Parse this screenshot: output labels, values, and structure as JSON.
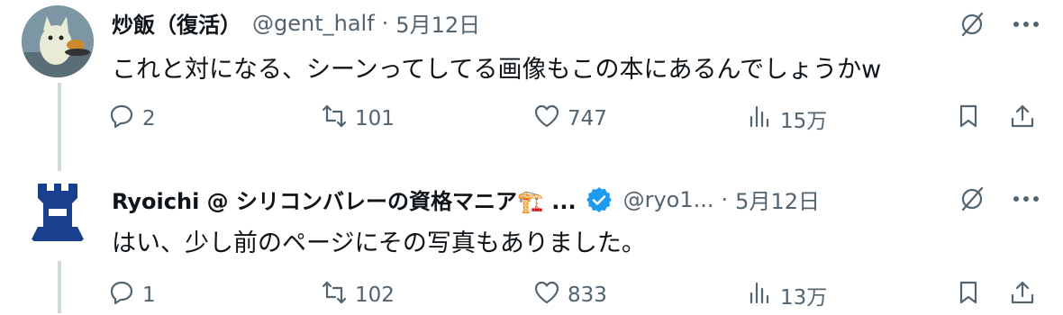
{
  "tweets": [
    {
      "name": "炒飯（復活）",
      "handle": "@gent_half",
      "separator": "·",
      "date": "5月12日",
      "text": "これと対になる、シーンってしてる画像もこの本にあるんでしょうかw",
      "replies": "2",
      "retweets": "101",
      "likes": "747",
      "views": "15万"
    },
    {
      "name": "Ryoichi @ シリコンバレーの資格マニア🏗️ ...",
      "handle": "@ryo1...",
      "separator": "·",
      "date": "5月12日",
      "text": "はい、少し前のページにその写真もありました。",
      "replies": "1",
      "retweets": "102",
      "likes": "833",
      "views": "13万",
      "verified": true
    }
  ],
  "colors": {
    "text": "#0f1419",
    "muted": "#536471",
    "verified": "#1d9bf0",
    "thread": "#cfd9de"
  },
  "icons": [
    "reply-icon",
    "retweet-icon",
    "like-icon",
    "views-icon",
    "bookmark-icon",
    "share-icon",
    "grok-icon",
    "more-icon"
  ]
}
